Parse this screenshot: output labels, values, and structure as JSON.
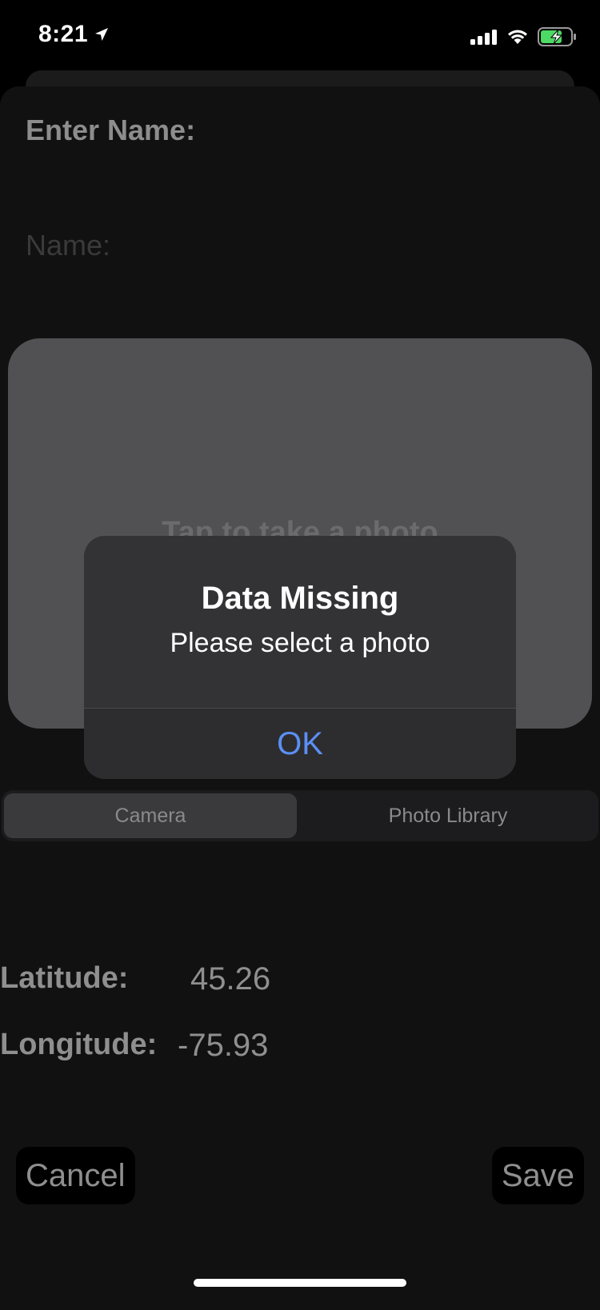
{
  "status_bar": {
    "time": "8:21",
    "battery_color": "#4cd964"
  },
  "form": {
    "enter_name_label": "Enter Name:",
    "name_placeholder": "Name:",
    "photo_hint": "Tap to take a photo"
  },
  "alert": {
    "title": "Data Missing",
    "message": "Please select a photo",
    "ok_label": "OK",
    "ok_color": "#5b8ff5"
  },
  "segmented": {
    "options": [
      "Camera",
      "Photo Library"
    ],
    "selected": "Camera"
  },
  "location": {
    "latitude_label": "Latitude:",
    "latitude_value": "45.26",
    "longitude_label": "Longitude:",
    "longitude_value": "-75.93"
  },
  "actions": {
    "cancel_label": "Cancel",
    "save_label": "Save"
  }
}
